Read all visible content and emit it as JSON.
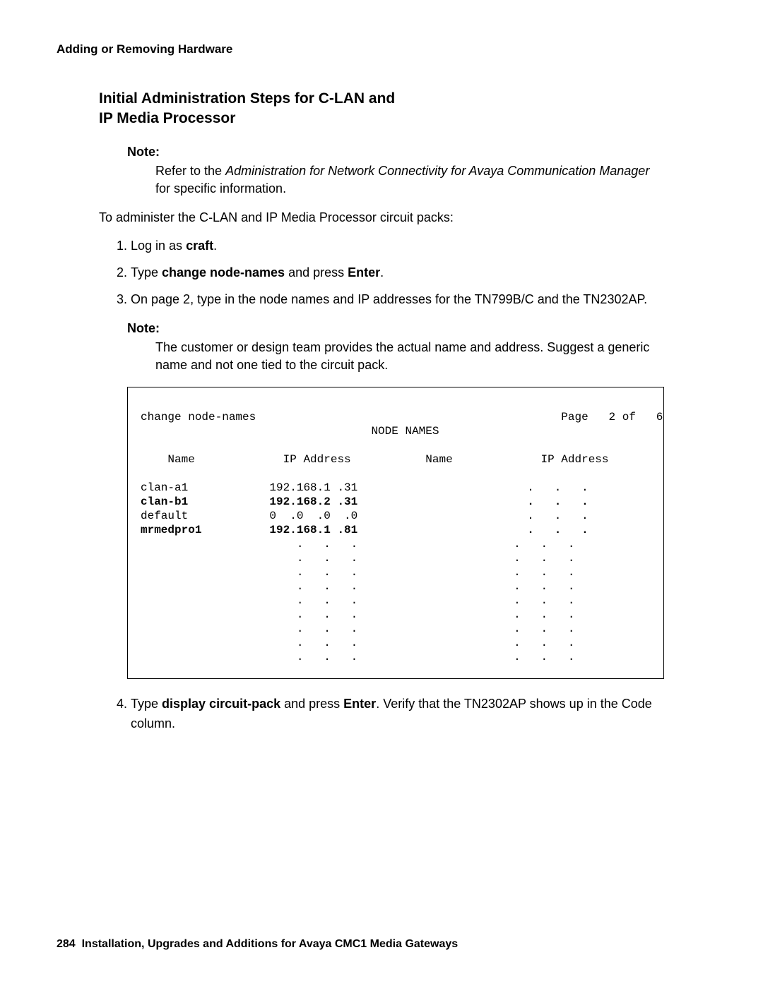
{
  "runningHeader": "Adding or Removing Hardware",
  "sectionTitleLine1": "Initial Administration Steps for C-LAN and",
  "sectionTitleLine2": "IP Media Processor",
  "note1Label": "Note:",
  "note1": {
    "pre": "Refer to the ",
    "italic": "Administration for Network Connectivity for Avaya Communication Manager",
    "post": " for specific information."
  },
  "intro": "To administer the C-LAN and IP Media Processor circuit packs:",
  "steps": {
    "s1": {
      "pre": "Log in as ",
      "b1": "craft",
      "post": "."
    },
    "s2": {
      "pre": "Type ",
      "b1": "change node-names",
      "mid": " and press ",
      "b2": "Enter",
      "post": "."
    },
    "s3": "On page 2, type in the node names and IP addresses for the TN799B/C and the TN2302AP.",
    "s4": {
      "pre": "Type ",
      "b1": "display circuit-pack",
      "mid": " and press ",
      "b2": "Enter",
      "post": ". Verify that the TN2302AP shows up in the Code column."
    }
  },
  "note2Label": "Note:",
  "note2Body": "The customer or design team provides the actual name and address. Suggest a generic name and not one tied to the circuit pack.",
  "terminal": {
    "line1": "change node-names                                             Page   2 of   6",
    "line2": "                                  NODE NAMES",
    "blank": " ",
    "header": "    Name             IP Address           Name             IP Address",
    "r1": "clan-a1            192.168.1 .31                         .   .   .",
    "r2": "clan-b1            192.168.2 .31                         .   .   .",
    "r3": "default            0  .0  .0  .0                         .   .   .",
    "r4": "mrmedpro1          192.168.1 .81                         .   .   .",
    "e": "                       .   .   .                       .   .   ."
  },
  "footerPageNum": "284",
  "footerText": "Installation, Upgrades and Additions for Avaya CMC1 Media Gateways"
}
